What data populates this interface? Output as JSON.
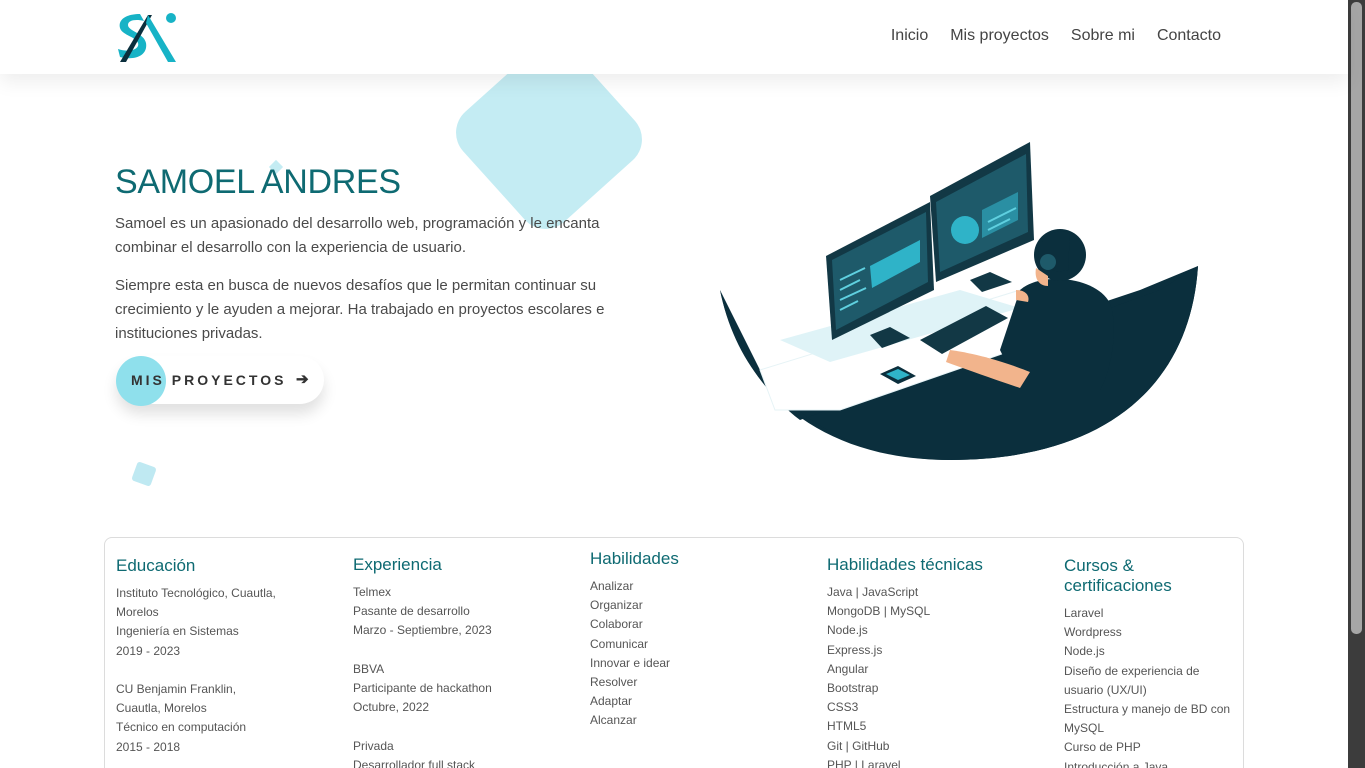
{
  "nav": {
    "items": [
      "Inicio",
      "Mis proyectos",
      "Sobre mi",
      "Contacto"
    ]
  },
  "hero": {
    "name": "SAMOEL ANDRES",
    "paragraph1": "Samoel es un apasionado del desarrollo web, programación y le encanta combinar el desarrollo con la experiencia de usuario.",
    "paragraph2": "Siempre esta en busca de nuevos desafíos que le permitan continuar su crecimiento y le ayuden a mejorar. Ha trabajado en proyectos escolares e instituciones privadas.",
    "cta_label": "MIS PROYECTOS",
    "cta_icon": "arrow-right-icon"
  },
  "colors": {
    "accent": "#0e6a72",
    "light_accent": "#8fe0ec",
    "dark": "#0b2f3d"
  },
  "sections": {
    "educacion": {
      "title": "Educación",
      "items": [
        "Instituto Tecnológico, Cuautla,",
        "Morelos",
        "Ingeniería en Sistemas",
        "2019 - 2023",
        "",
        "CU Benjamin Franklin,",
        "Cuautla, Morelos",
        "Técnico en computación",
        "2015 - 2018"
      ]
    },
    "experiencia": {
      "title": "Experiencia",
      "items": [
        "Telmex",
        "Pasante de desarrollo",
        "Marzo - Septiembre, 2023",
        "",
        "BBVA",
        "Participante de hackathon",
        "Octubre, 2022",
        "",
        "Privada",
        "Desarrollador full stack"
      ]
    },
    "habilidades": {
      "title": "Habilidades",
      "items": [
        "Analizar",
        "Organizar",
        "Colaborar",
        "Comunicar",
        "Innovar e idear",
        "Resolver",
        "Adaptar",
        "Alcanzar"
      ]
    },
    "tecnicas": {
      "title": "Habilidades técnicas",
      "items": [
        "Java | JavaScript",
        "MongoDB | MySQL",
        "Node.js",
        "Express.js",
        "Angular",
        "Bootstrap",
        "CSS3",
        "HTML5",
        "Git | GitHub",
        "PHP | Laravel"
      ]
    },
    "cursos": {
      "title": "Cursos & certificaciones",
      "items": [
        "Laravel",
        "Wordpress",
        "Node.js",
        "Diseño de experiencia de",
        "usuario (UX/UI)",
        "Estructura y manejo de BD con",
        "MySQL",
        "Curso de PHP",
        "Introducción a Java"
      ]
    }
  }
}
